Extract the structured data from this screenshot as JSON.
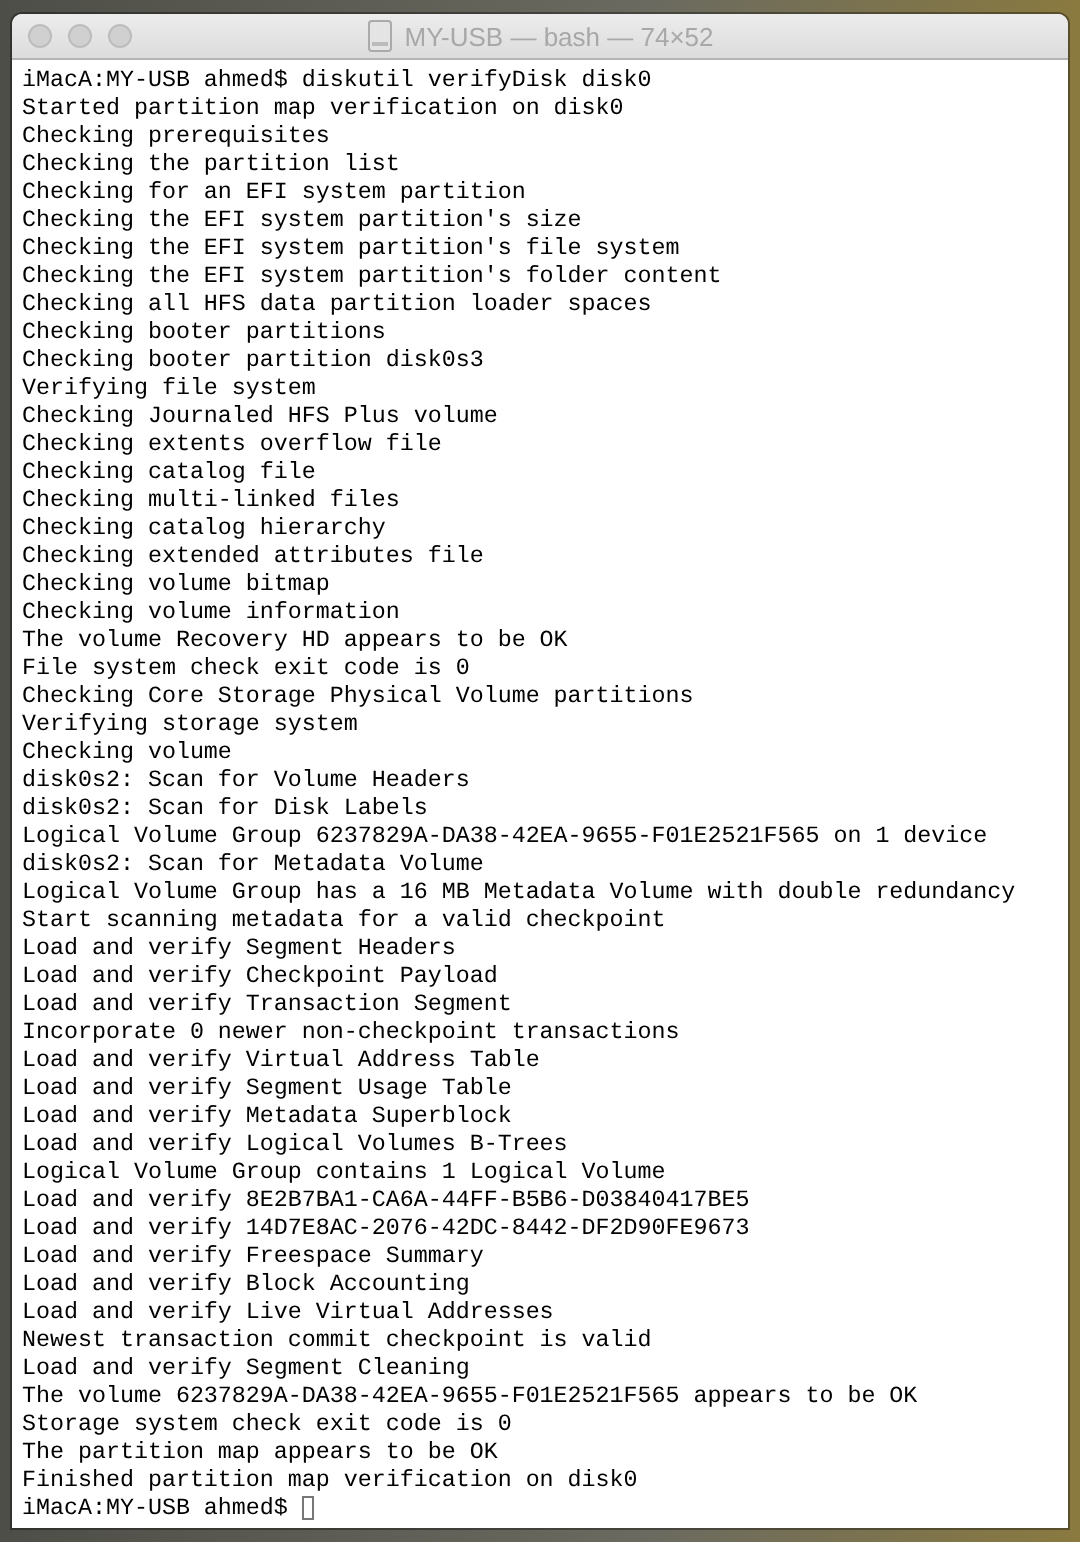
{
  "window": {
    "title": "MY-USB — bash — 74×52",
    "focused": false
  },
  "terminal": {
    "lines": [
      "iMacA:MY-USB ahmed$ diskutil verifyDisk disk0",
      "Started partition map verification on disk0",
      "Checking prerequisites",
      "Checking the partition list",
      "Checking for an EFI system partition",
      "Checking the EFI system partition's size",
      "Checking the EFI system partition's file system",
      "Checking the EFI system partition's folder content",
      "Checking all HFS data partition loader spaces",
      "Checking booter partitions",
      "Checking booter partition disk0s3",
      "Verifying file system",
      "Checking Journaled HFS Plus volume",
      "Checking extents overflow file",
      "Checking catalog file",
      "Checking multi-linked files",
      "Checking catalog hierarchy",
      "Checking extended attributes file",
      "Checking volume bitmap",
      "Checking volume information",
      "The volume Recovery HD appears to be OK",
      "File system check exit code is 0",
      "Checking Core Storage Physical Volume partitions",
      "Verifying storage system",
      "Checking volume",
      "disk0s2: Scan for Volume Headers",
      "disk0s2: Scan for Disk Labels",
      "Logical Volume Group 6237829A-DA38-42EA-9655-F01E2521F565 on 1 device",
      "disk0s2: Scan for Metadata Volume",
      "Logical Volume Group has a 16 MB Metadata Volume with double redundancy",
      "Start scanning metadata for a valid checkpoint",
      "Load and verify Segment Headers",
      "Load and verify Checkpoint Payload",
      "Load and verify Transaction Segment",
      "Incorporate 0 newer non-checkpoint transactions",
      "Load and verify Virtual Address Table",
      "Load and verify Segment Usage Table",
      "Load and verify Metadata Superblock",
      "Load and verify Logical Volumes B-Trees",
      "Logical Volume Group contains 1 Logical Volume",
      "Load and verify 8E2B7BA1-CA6A-44FF-B5B6-D03840417BE5",
      "Load and verify 14D7E8AC-2076-42DC-8442-DF2D90FE9673",
      "Load and verify Freespace Summary",
      "Load and verify Block Accounting",
      "Load and verify Live Virtual Addresses",
      "Newest transaction commit checkpoint is valid",
      "Load and verify Segment Cleaning",
      "The volume 6237829A-DA38-42EA-9655-F01E2521F565 appears to be OK",
      "Storage system check exit code is 0",
      "The partition map appears to be OK",
      "Finished partition map verification on disk0"
    ],
    "prompt": "iMacA:MY-USB ahmed$"
  }
}
